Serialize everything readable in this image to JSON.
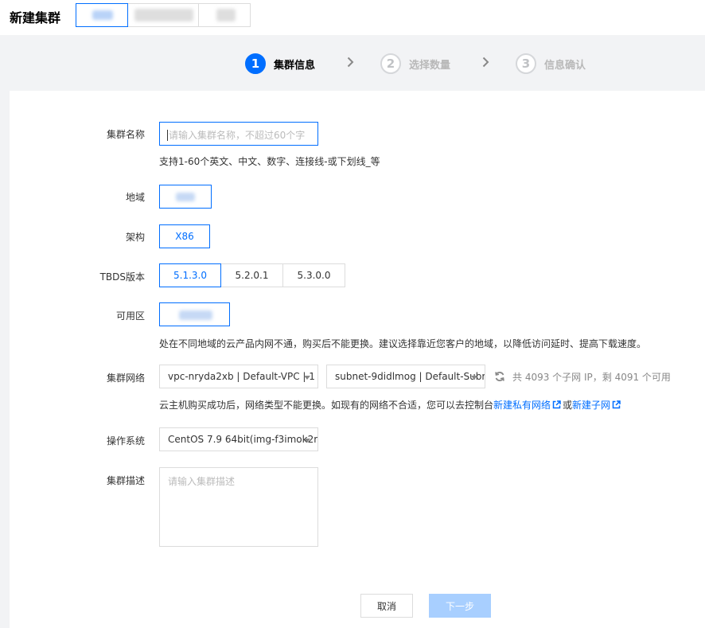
{
  "header": {
    "title": "新建集群"
  },
  "steps": [
    {
      "num": "1",
      "label": "集群信息"
    },
    {
      "num": "2",
      "label": "选择数量"
    },
    {
      "num": "3",
      "label": "信息确认"
    }
  ],
  "step_separator": "›",
  "form": {
    "name": {
      "label": "集群名称",
      "placeholder": "请输入集群名称，不超过60个字",
      "hint": "支持1-60个英文、中文、数字、连接线-或下划线_等"
    },
    "region": {
      "label": "地域"
    },
    "arch": {
      "label": "架构",
      "options": [
        "X86"
      ]
    },
    "version": {
      "label": "TBDS版本",
      "options": [
        "5.1.3.0",
        "5.2.0.1",
        "5.3.0.0"
      ],
      "selected": "5.1.3.0"
    },
    "zone": {
      "label": "可用区",
      "hint": "处在不同地域的云产品内网不通，购买后不能更换。建议选择靠近您客户的地域，以降低访问延时、提高下载速度。"
    },
    "network": {
      "label": "集群网络",
      "vpc_value": "vpc-nryda2xb | Default-VPC | 1",
      "subnet_value": "subnet-9didlmog | Default-Subr",
      "ip_info": "共 4093 个子网 IP，剩 4091 个可用",
      "hint_prefix": "云主机购买成功后，网络类型不能更换。如现有的网络不合适，您可以去控制台",
      "link_vpc": "新建私有网络",
      "hint_or": "或",
      "link_subnet": "新建子网"
    },
    "os": {
      "label": "操作系统",
      "value": "CentOS 7.9 64bit(img-f3imok2r"
    },
    "desc": {
      "label": "集群描述",
      "placeholder": "请输入集群描述"
    }
  },
  "actions": {
    "cancel_label": "取消",
    "next_label": "下一步"
  },
  "colors": {
    "accent": "#006eff",
    "disabled_primary": "#a8cfff",
    "border": "#dcdcdc"
  }
}
